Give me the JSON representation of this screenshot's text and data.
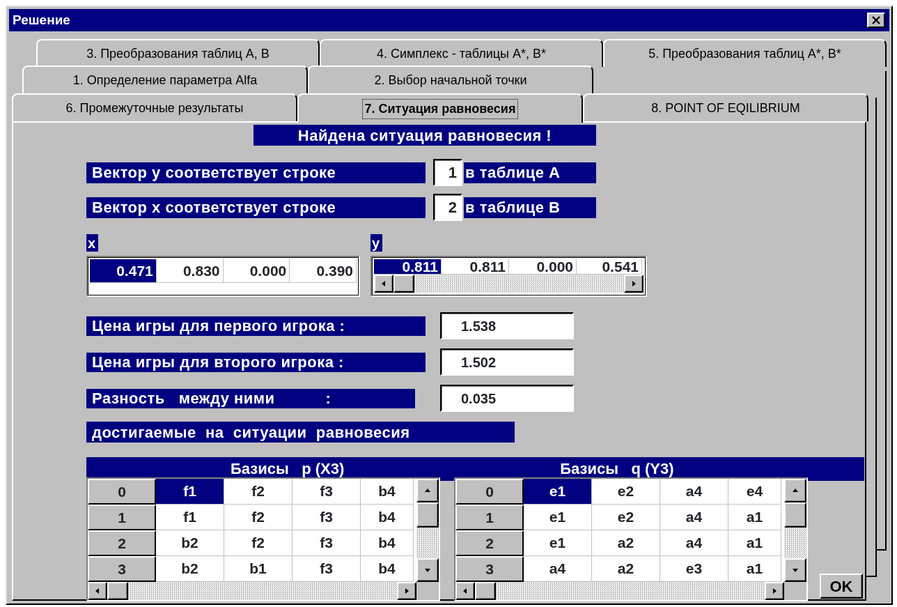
{
  "window": {
    "title": "Решение"
  },
  "tab_rows": [
    [
      {
        "label": "3. Преобразования таблиц А, В",
        "selected": false
      },
      {
        "label": "4. Симплекс - таблицы А*, В*",
        "selected": false
      },
      {
        "label": "5. Преобразования таблиц А*, В*",
        "selected": false
      }
    ],
    [
      {
        "label": "1. Определение параметра Alfa",
        "selected": false
      },
      {
        "label": "2. Выбор начальной точки",
        "selected": false
      }
    ],
    [
      {
        "label": "6. Промежуточные результаты",
        "selected": false
      },
      {
        "label": "7. Ситуация равновесия",
        "selected": true
      },
      {
        "label": "8. POINT OF EQILIBRIUM",
        "selected": false
      }
    ]
  ],
  "banner": "Найдена ситуация равновесия !",
  "vector_rows": [
    {
      "label": "Вектор y соответствует строке",
      "value": "1",
      "suffix": "в таблице А"
    },
    {
      "label": "Вектор x соответствует строке",
      "value": "2",
      "suffix": "в таблице В"
    }
  ],
  "vectors": [
    {
      "label": "x",
      "values": [
        {
          "text": "0.471",
          "selected": true
        },
        {
          "text": "0.830",
          "selected": false
        },
        {
          "text": "0.000",
          "selected": false
        },
        {
          "text": "0.390",
          "selected": false
        }
      ]
    },
    {
      "label": "y",
      "values": [
        {
          "text": "0.811",
          "selected": true
        },
        {
          "text": "0.811",
          "selected": false
        },
        {
          "text": "0.000",
          "selected": false
        },
        {
          "text": "0.541",
          "selected": false
        }
      ]
    }
  ],
  "prices": [
    {
      "label": "Цена игры для первого игрока :",
      "value": "1.538"
    },
    {
      "label": "Цена игры для второго игрока :",
      "value": "1.502"
    },
    {
      "label": "Разность   между ними           :",
      "value": "0.035"
    }
  ],
  "note": "достигаемые  на  ситуации  равновесия",
  "bases": [
    {
      "title": "Базисы   p (X3)",
      "rows": [
        {
          "index": "0",
          "cells": [
            {
              "text": "f1",
              "selected": true
            },
            {
              "text": "f2",
              "selected": false
            },
            {
              "text": "f3",
              "selected": false
            },
            {
              "text": "b4",
              "selected": false
            }
          ]
        },
        {
          "index": "1",
          "cells": [
            {
              "text": "f1",
              "selected": false
            },
            {
              "text": "f2",
              "selected": false
            },
            {
              "text": "f3",
              "selected": false
            },
            {
              "text": "b4",
              "selected": false
            }
          ]
        },
        {
          "index": "2",
          "cells": [
            {
              "text": "b2",
              "selected": false
            },
            {
              "text": "f2",
              "selected": false
            },
            {
              "text": "f3",
              "selected": false
            },
            {
              "text": "b4",
              "selected": false
            }
          ]
        },
        {
          "index": "3",
          "cells": [
            {
              "text": "b2",
              "selected": false
            },
            {
              "text": "b1",
              "selected": false
            },
            {
              "text": "f3",
              "selected": false
            },
            {
              "text": "b4",
              "selected": false
            }
          ]
        }
      ]
    },
    {
      "title": "Базисы   q (Y3)",
      "rows": [
        {
          "index": "0",
          "cells": [
            {
              "text": "e1",
              "selected": true
            },
            {
              "text": "e2",
              "selected": false
            },
            {
              "text": "a4",
              "selected": false
            },
            {
              "text": "e4",
              "selected": false
            }
          ]
        },
        {
          "index": "1",
          "cells": [
            {
              "text": "e1",
              "selected": false
            },
            {
              "text": "e2",
              "selected": false
            },
            {
              "text": "a4",
              "selected": false
            },
            {
              "text": "a1",
              "selected": false
            }
          ]
        },
        {
          "index": "2",
          "cells": [
            {
              "text": "e1",
              "selected": false
            },
            {
              "text": "a2",
              "selected": false
            },
            {
              "text": "a4",
              "selected": false
            },
            {
              "text": "a1",
              "selected": false
            }
          ]
        },
        {
          "index": "3",
          "cells": [
            {
              "text": "a4",
              "selected": false
            },
            {
              "text": "a2",
              "selected": false
            },
            {
              "text": "e3",
              "selected": false
            },
            {
              "text": "a1",
              "selected": false
            }
          ]
        }
      ]
    }
  ],
  "ok_button": "OK"
}
